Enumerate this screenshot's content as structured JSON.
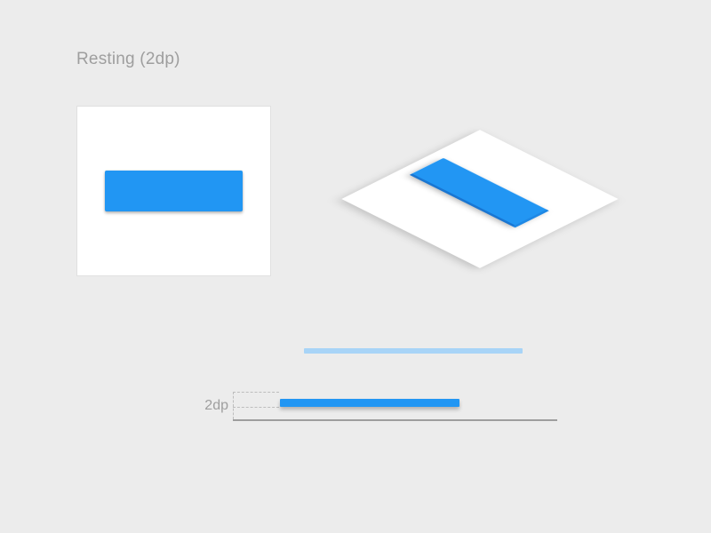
{
  "title": "Resting (2dp)",
  "elevation_label": "2dp",
  "colors": {
    "primary": "#2196F3",
    "primary_light": "#A8D4F7",
    "surface": "#FFFFFF",
    "background": "#ECECEC",
    "outline": "#E0E0E0",
    "text_muted": "#9E9E9E"
  },
  "chart_data": {
    "type": "diagram",
    "title": "Material Design button resting elevation",
    "panels": [
      {
        "name": "top-down",
        "description": "White card with a raised blue button at 2dp resting elevation",
        "button_elevation_dp": 2
      },
      {
        "name": "isometric",
        "description": "Isometric view of the same card and button showing cast shadow",
        "button_elevation_dp": 2
      },
      {
        "name": "side-view",
        "description": "Cross-section showing the 2dp gap between button and surface",
        "layers": [
          {
            "name": "background surface",
            "z_dp": 0
          },
          {
            "name": "button",
            "z_dp": 2
          }
        ],
        "annotation": "2dp"
      }
    ]
  }
}
